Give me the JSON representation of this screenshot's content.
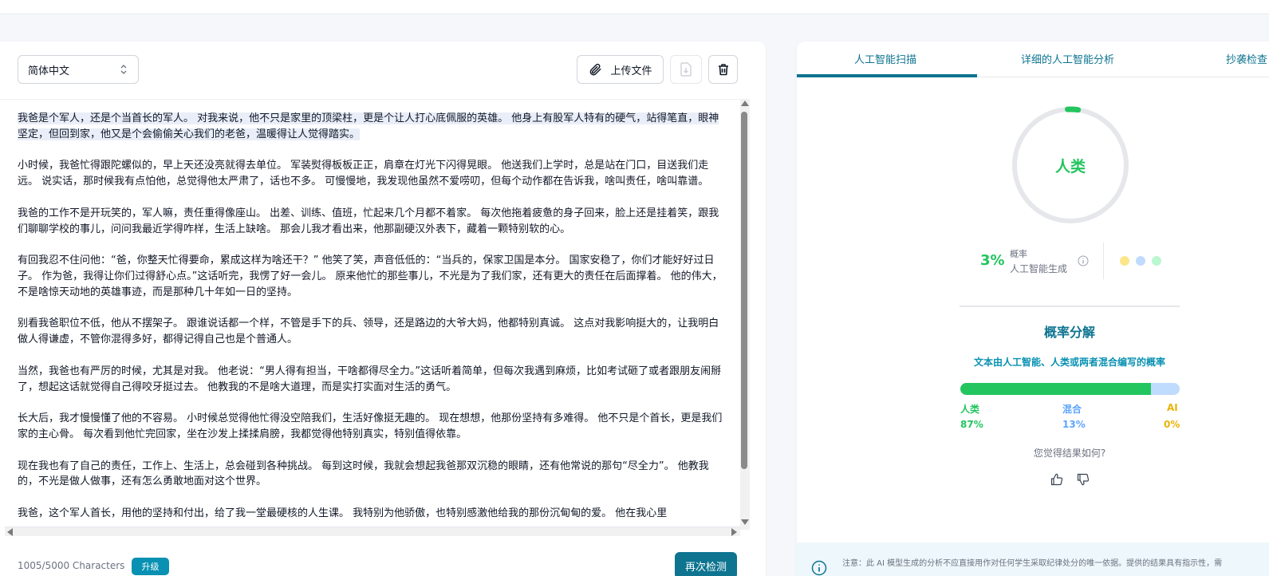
{
  "editor": {
    "language": "简体中文",
    "upload_label": "上传文件",
    "paragraphs": [
      "我爸是个军人，还是个当首长的军人。 对我来说，他不只是家里的顶梁柱，更是个让人打心底佩服的英雄。 他身上有股军人特有的硬气，站得笔直，眼神坚定，但回到家，他又是个会偷偷关心我们的老爸，温暖得让人觉得踏实。",
      "小时候，我爸忙得跟陀螺似的，早上天还没亮就得去单位。 军装熨得板板正正，肩章在灯光下闪得晃眼。 他送我们上学时，总是站在门口，目送我们走远。 说实话，那时候我有点怕他，总觉得他太严肃了，话也不多。 可慢慢地，我发现他虽然不爱唠叨，但每个动作都在告诉我，啥叫责任，啥叫靠谱。",
      "我爸的工作不是开玩笑的，军人嘛，责任重得像座山。 出差、训练、值班，忙起来几个月都不着家。 每次他拖着疲惫的身子回来，脸上还是挂着笑，跟我们聊聊学校的事儿，问问我最近学得咋样，生活上缺啥。 那会儿我才看出来，他那副硬汉外表下，藏着一颗特别软的心。",
      "有回我忍不住问他：“爸，你整天忙得要命，累成这样为啥还干？” 他笑了笑，声音低低的：“当兵的，保家卫国是本分。 国家安稳了，你们才能好好过日子。 作为爸，我得让你们过得舒心点。”这话听完，我愣了好一会儿。 原来他忙的那些事儿，不光是为了我们家，还有更大的责任在后面撑着。 他的伟大，不是啥惊天动地的英雄事迹，而是那种几十年如一日的坚持。",
      "别看我爸职位不低，他从不摆架子。 跟谁说话都一个样，不管是手下的兵、领导，还是路边的大爷大妈，他都特别真诚。 这点对我影响挺大的，让我明白做人得谦虚，不管你混得多好，都得记得自己也是个普通人。",
      "当然，我爸也有严厉的时候，尤其是对我。 他老说：“男人得有担当，干啥都得尽全力。”这话听着简单，但每次我遇到麻烦，比如考试砸了或者跟朋友闹掰了，想起这话就觉得自己得咬牙挺过去。 他教我的不是啥大道理，而是实打实面对生活的勇气。",
      "长大后，我才慢慢懂了他的不容易。 小时候总觉得他忙得没空陪我们，生活好像挺无趣的。 现在想想，他那份坚持有多难得。 他不只是个首长，更是我们家的主心骨。 每次看到他忙完回家，坐在沙发上揉揉肩膀，我都觉得他特别真实，特别值得依靠。",
      "现在我也有了自己的责任，工作上、生活上，总会碰到各种挑战。 每到这时候，我就会想起我爸那双沉稳的眼睛，还有他常说的那句“尽全力”。 他教我的，不光是做人做事，还有怎么勇敢地面对这个世界。",
      "我爸，这个军人首长，用他的坚持和付出，给了我一堂最硬核的人生课。 我特别为他骄傲，也特别感激他给我的那份沉甸甸的爱。 他在我心里"
    ],
    "char_count": "1005/5000 Characters",
    "upgrade_label": "升级",
    "recheck_label": "再次检测"
  },
  "result": {
    "tabs": [
      "人工智能扫描",
      "详细的人工智能分析",
      "抄袭检查"
    ],
    "verdict": "人类",
    "probability": "3%",
    "probability_caption": "概率",
    "probability_sub": "人工智能生成",
    "breakdown_title": "概率分解",
    "breakdown_subtitle": "文本由人工智能、人类或两者混合编写的概率",
    "legend": [
      {
        "label": "人类",
        "value": "87%",
        "color": "#22c55e",
        "pct": 87
      },
      {
        "label": "混合",
        "value": "13%",
        "color": "#60a5fa",
        "pct": 13
      },
      {
        "label": "AI",
        "value": "0%",
        "color": "#eab308",
        "pct": 0
      }
    ],
    "bar_colors": {
      "human": "#22c55e",
      "mixed": "#bfdbfe",
      "ai": "#fde68a"
    },
    "dot_colors": [
      "#fde68a",
      "#bfdbfe",
      "#bbf7d0"
    ],
    "feedback_question": "您觉得结果如何?",
    "notice": "注意：此 AI 模型生成的分析不应直接用作对任何学生采取纪律处分的唯一依据。提供的结果具有指示性，需"
  },
  "icons": {
    "chevron": "chevron-up-down-icon",
    "paperclip": "paperclip-icon",
    "download": "download-file-icon",
    "trash": "trash-icon",
    "info": "info-icon",
    "thumb_up": "thumbs-up-icon",
    "thumb_down": "thumbs-down-icon"
  },
  "colors": {
    "accent": "#0e7490",
    "human_green": "#22c55e"
  }
}
